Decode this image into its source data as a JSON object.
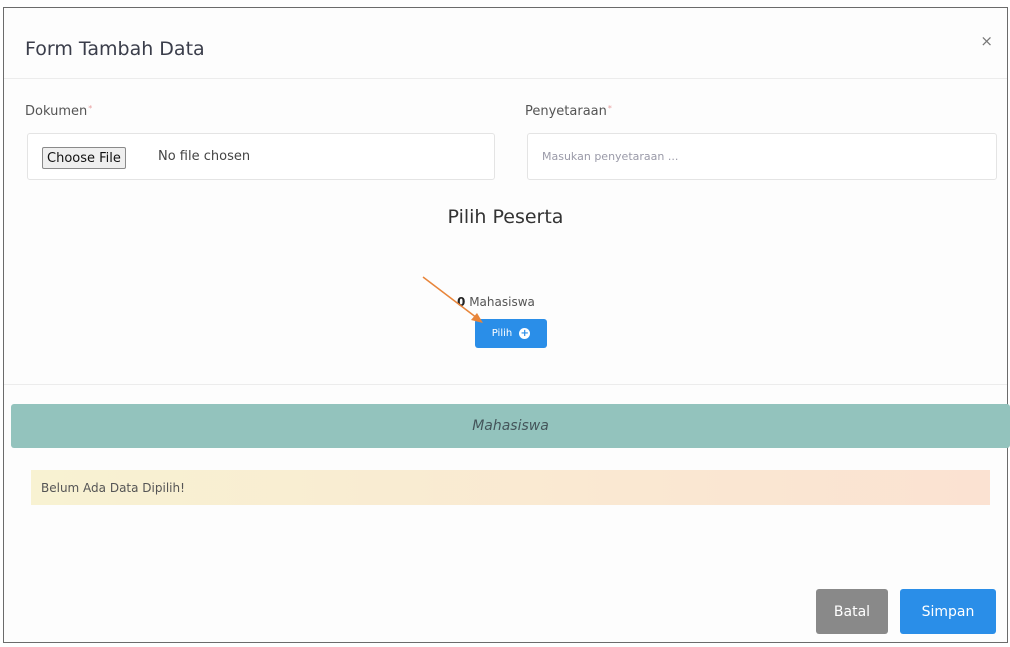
{
  "modal": {
    "title": "Form Tambah Data",
    "close_icon": "×"
  },
  "form": {
    "dokumen_label": "Dokumen",
    "file_button_label": "Choose File",
    "file_status": "No file chosen",
    "penyetaraan_label": "Penyetaraan",
    "penyetaraan_placeholder": "Masukan penyetaraan ...",
    "penyetaraan_value": ""
  },
  "peserta": {
    "title": "Pilih Peserta",
    "count": "0",
    "count_label": "Mahasiswa",
    "pilih_button_label": "Pilih",
    "pilih_icon": "plus-circle-icon"
  },
  "table": {
    "header": "Mahasiswa",
    "empty_message": "Belum Ada Data Dipilih!"
  },
  "footer": {
    "cancel_label": "Batal",
    "save_label": "Simpan"
  },
  "colors": {
    "primary": "#2a8ee8",
    "table_header": "#93c3bd",
    "cancel": "#898989",
    "annotation_arrow": "#e8853a"
  }
}
